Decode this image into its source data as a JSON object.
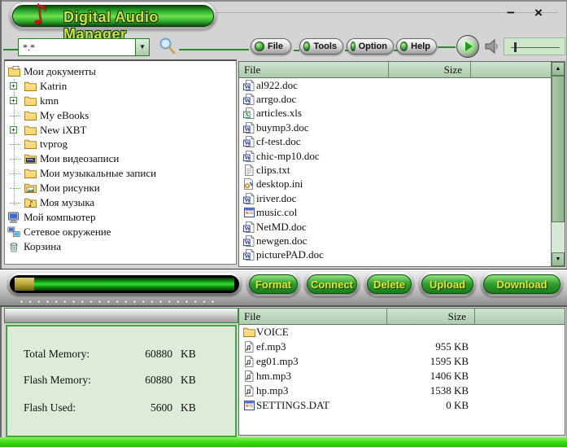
{
  "window": {
    "title": "Digital Audio Manager",
    "minimize": "−",
    "close": "×"
  },
  "toolbar": {
    "filter_value": "*.*",
    "menus": [
      {
        "label": "File"
      },
      {
        "label": "Tools"
      },
      {
        "label": "Option"
      },
      {
        "label": "Help"
      }
    ]
  },
  "tree": {
    "items": [
      {
        "label": "Мои документы",
        "icon": "folder-documents-icon",
        "level": 0,
        "expandable": false
      },
      {
        "label": "Katrin",
        "icon": "folder-icon",
        "level": 1,
        "expandable": true
      },
      {
        "label": "kmn",
        "icon": "folder-icon",
        "level": 1,
        "expandable": true
      },
      {
        "label": "My eBooks",
        "icon": "folder-icon",
        "level": 1,
        "expandable": false
      },
      {
        "label": "New iXBT",
        "icon": "folder-icon",
        "level": 1,
        "expandable": true
      },
      {
        "label": "tvprog",
        "icon": "folder-icon",
        "level": 1,
        "expandable": false
      },
      {
        "label": "Мои видеозаписи",
        "icon": "folder-video-icon",
        "level": 1,
        "expandable": false
      },
      {
        "label": "Мои музыкальные записи",
        "icon": "folder-icon",
        "level": 1,
        "expandable": false
      },
      {
        "label": "Мои рисунки",
        "icon": "folder-picture-icon",
        "level": 1,
        "expandable": false
      },
      {
        "label": "Моя музыка",
        "icon": "folder-music-icon",
        "level": 1,
        "expandable": false
      },
      {
        "label": "Мой компьютер",
        "icon": "computer-icon",
        "level": 0,
        "expandable": false
      },
      {
        "label": "Сетевое окружение",
        "icon": "network-icon",
        "level": 0,
        "expandable": false
      },
      {
        "label": "Корзина",
        "icon": "recycle-bin-icon",
        "level": 0,
        "expandable": false
      }
    ]
  },
  "top_files": {
    "columns": {
      "file": "File",
      "size": "Size"
    },
    "rows": [
      {
        "name": "al922.doc",
        "icon": "word-doc-icon",
        "size": ""
      },
      {
        "name": "arrgo.doc",
        "icon": "word-doc-icon",
        "size": ""
      },
      {
        "name": "articles.xls",
        "icon": "excel-icon",
        "size": ""
      },
      {
        "name": "buymp3.doc",
        "icon": "word-doc-icon",
        "size": ""
      },
      {
        "name": "cf-test.doc",
        "icon": "word-doc-icon",
        "size": ""
      },
      {
        "name": "chic-mp10.doc",
        "icon": "word-doc-icon",
        "size": ""
      },
      {
        "name": "clips.txt",
        "icon": "text-file-icon",
        "size": ""
      },
      {
        "name": "desktop.ini",
        "icon": "ini-file-icon",
        "size": ""
      },
      {
        "name": "iriver.doc",
        "icon": "word-doc-icon",
        "size": ""
      },
      {
        "name": "music.col",
        "icon": "media-file-icon",
        "size": ""
      },
      {
        "name": "NetMD.doc",
        "icon": "word-doc-icon",
        "size": ""
      },
      {
        "name": "newgen.doc",
        "icon": "word-doc-icon",
        "size": ""
      },
      {
        "name": "picturePAD.doc",
        "icon": "word-doc-icon",
        "size": ""
      }
    ]
  },
  "actions": [
    {
      "label": "Format"
    },
    {
      "label": "Connect"
    },
    {
      "label": "Delete"
    },
    {
      "label": "Upload"
    },
    {
      "label": "Download"
    }
  ],
  "memory": {
    "rows": [
      {
        "label": "Total Memory:",
        "value": "60880",
        "unit": "KB"
      },
      {
        "label": "Flash Memory:",
        "value": "60880",
        "unit": "KB"
      },
      {
        "label": "Flash Used:",
        "value": "5600",
        "unit": "KB"
      }
    ]
  },
  "bottom_files": {
    "columns": {
      "file": "File",
      "size": "Size"
    },
    "rows": [
      {
        "name": "VOICE",
        "icon": "folder-icon",
        "size": ""
      },
      {
        "name": "ef.mp3",
        "icon": "audio-file-icon",
        "size": "955 KB"
      },
      {
        "name": "eg01.mp3",
        "icon": "audio-file-icon",
        "size": "1595 KB"
      },
      {
        "name": "hm.mp3",
        "icon": "audio-file-icon",
        "size": "1406 KB"
      },
      {
        "name": "hp.mp3",
        "icon": "audio-file-icon",
        "size": "1538 KB"
      },
      {
        "name": "SETTINGS.DAT",
        "icon": "settings-file-icon",
        "size": "0 KB"
      }
    ]
  },
  "colors": {
    "accent_green": "#2fae2f",
    "title_text": "#cfe23c",
    "button_text": "#e8e428",
    "header_bg": "#b9d2b9",
    "panel_green": "#dcecd8",
    "bottom_strip": "#3fdf17"
  }
}
